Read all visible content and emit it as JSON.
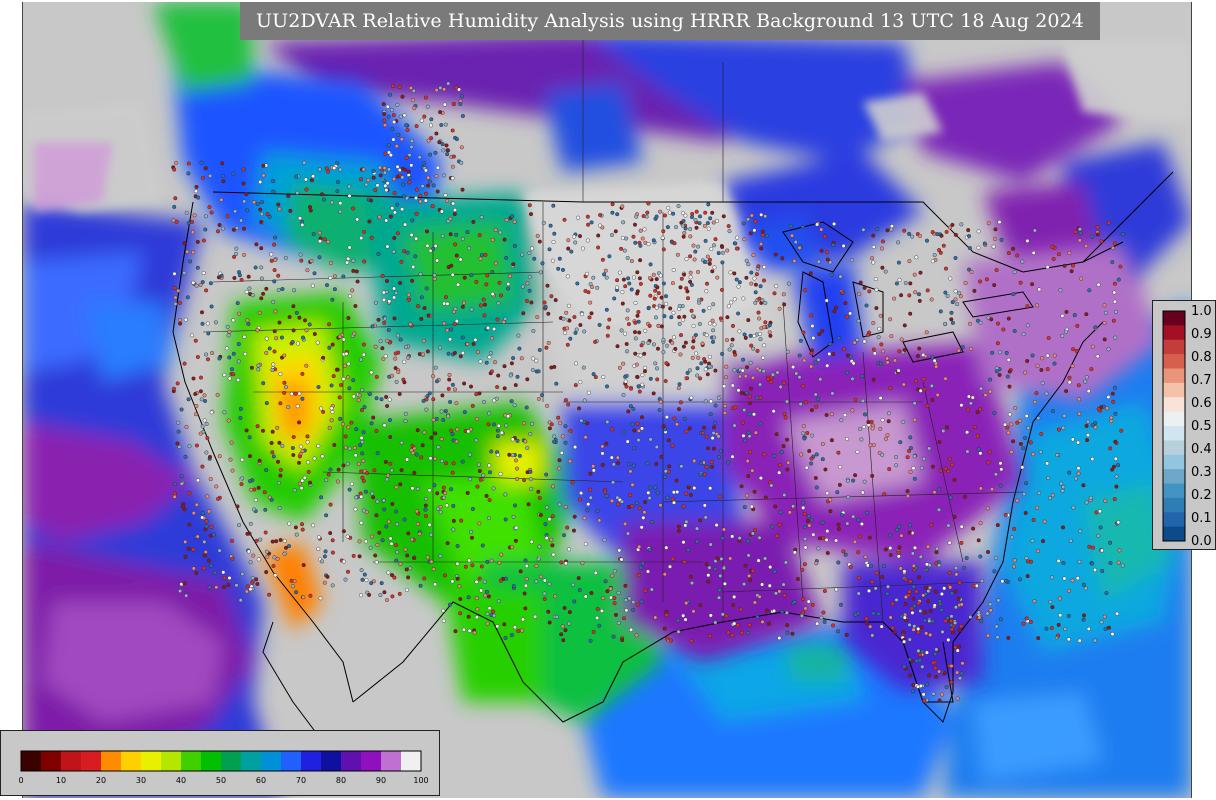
{
  "title": "UU2DVAR Relative Humidity Analysis using HRRR Background 13 UTC 18 Aug 2024",
  "map": {
    "field": "relative humidity",
    "background_color": "#c8c8c8",
    "land_palette": [
      "#0000cc",
      "#3d5bff",
      "#00a0e0",
      "#00c0a0",
      "#00b400",
      "#20d000",
      "#ffff00",
      "#ffa000",
      "#d01010"
    ],
    "station_marker_colors": [
      "#8b1a1a",
      "#d73027",
      "#e9897a",
      "#f5f5f5",
      "#8fb4c8",
      "#2c6fa8"
    ]
  },
  "obs_colorbar": {
    "ticks": [
      "1.0",
      "0.9",
      "0.8",
      "0.7",
      "0.6",
      "0.5",
      "0.4",
      "0.3",
      "0.2",
      "0.1",
      "0.0"
    ],
    "colors": [
      "#67001f",
      "#a50f24",
      "#c43c3c",
      "#d6604d",
      "#e8957a",
      "#f4c2a8",
      "#f7e3da",
      "#ecf0f2",
      "#d1e5f0",
      "#b8d0dc",
      "#92c5de",
      "#6ea8c8",
      "#4393c3",
      "#2f7db5",
      "#2166ac",
      "#0d4a8a"
    ]
  },
  "rh_colorbar": {
    "ticks": [
      "0",
      "10",
      "20",
      "30",
      "40",
      "50",
      "60",
      "70",
      "80",
      "90",
      "100"
    ],
    "colors": [
      "#3b0000",
      "#800000",
      "#c0141a",
      "#d81c20",
      "#ff8c00",
      "#ffd000",
      "#e8f000",
      "#b4e600",
      "#40d000",
      "#00c000",
      "#00a050",
      "#00a0a0",
      "#0090d8",
      "#2060ff",
      "#2020e0",
      "#1010a0",
      "#6010b0",
      "#9010c0",
      "#c070d0",
      "#f0f0f0"
    ]
  }
}
